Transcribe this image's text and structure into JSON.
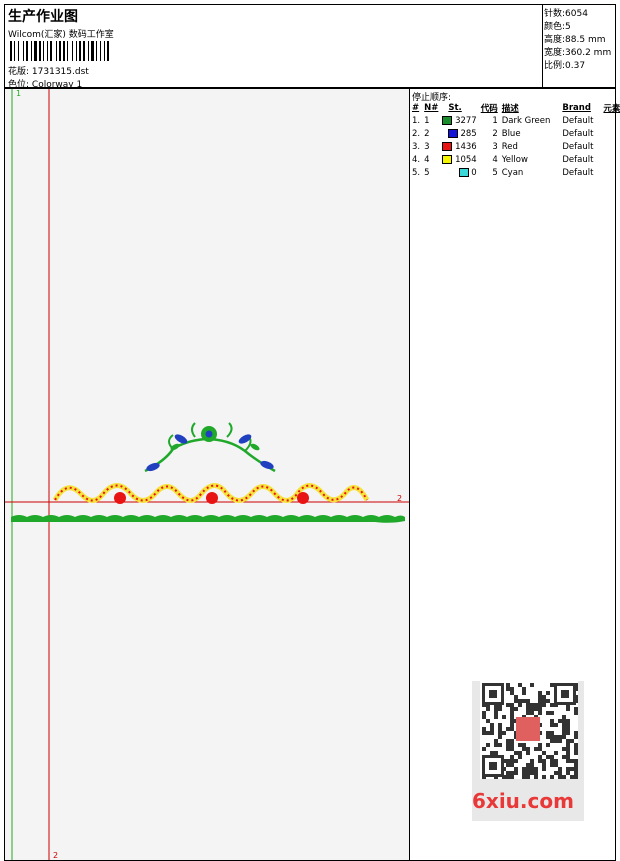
{
  "header": {
    "title": "生产作业图",
    "studio": "Wilcom(汇家) 数码工作室",
    "design_label": "花版:",
    "design_value": "1731315.dst",
    "colorway_label": "色位:",
    "colorway_value": "Colorway 1"
  },
  "stats": [
    {
      "label": "针数:",
      "value": "6054"
    },
    {
      "label": "颜色:",
      "value": "5"
    },
    {
      "label": "高度:",
      "value": "88.5 mm"
    },
    {
      "label": "宽度:",
      "value": "360.2 mm"
    },
    {
      "label": "比例:",
      "value": "0.37"
    }
  ],
  "canvas": {
    "marker_top": "1",
    "marker_right": "2",
    "marker_bottom": "2"
  },
  "stop_sequence": {
    "title": "停止顺序:",
    "headers": [
      "#",
      "N#",
      "St.",
      "代码",
      "描述",
      "Brand",
      "元素"
    ],
    "rows": [
      {
        "idx": "1.",
        "n": "1",
        "color": "#1a8c2a",
        "st": "3277",
        "code": "1",
        "desc": "Dark Green",
        "brand": "Default"
      },
      {
        "idx": "2.",
        "n": "2",
        "color": "#1414d8",
        "st": "285",
        "code": "2",
        "desc": "Blue",
        "brand": "Default"
      },
      {
        "idx": "3.",
        "n": "3",
        "color": "#e81414",
        "st": "1436",
        "code": "3",
        "desc": "Red",
        "brand": "Default"
      },
      {
        "idx": "4.",
        "n": "4",
        "color": "#f5f500",
        "st": "1054",
        "code": "4",
        "desc": "Yellow",
        "brand": "Default"
      },
      {
        "idx": "5.",
        "n": "5",
        "color": "#3ad8d8",
        "st": "0",
        "code": "5",
        "desc": "Cyan",
        "brand": "Default"
      }
    ]
  },
  "watermark": {
    "site": "6xiu.com"
  },
  "colors": {
    "green": "#1fa82a",
    "red": "#e81414",
    "yellow": "#f5e23a",
    "blue": "#2040c0",
    "guide_red": "#cc0000",
    "guide_green": "#22aa22"
  }
}
